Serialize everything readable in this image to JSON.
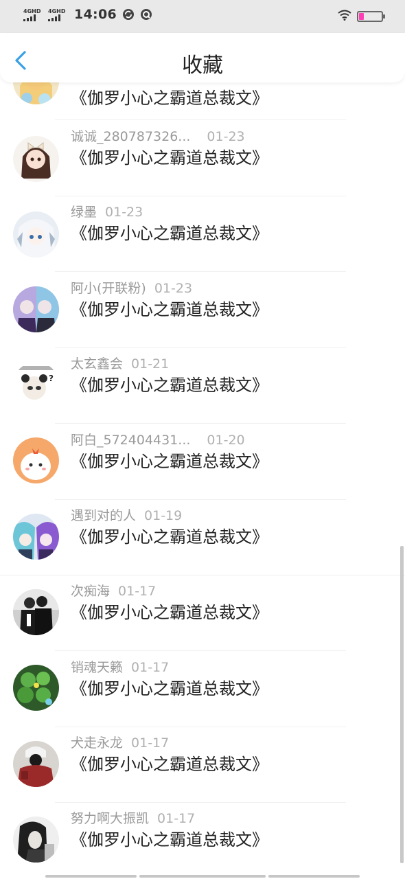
{
  "status_bar": {
    "net1": "4GHD",
    "net2": "4GHD",
    "time": "14:06",
    "battery_color": "#ff3fb4",
    "battery_level": 0.2
  },
  "header": {
    "title": "收藏",
    "back_icon": "chevron-left-icon",
    "accent_color": "#3aa0e6"
  },
  "items": [
    {
      "user": "",
      "date": "",
      "title": "《伽罗小心之霸道总裁文》",
      "avatar": "anime-girl-yellow"
    },
    {
      "user": "诚诚_280787326...",
      "date": "01-23",
      "title": "《伽罗小心之霸道总裁文》",
      "avatar": "anime-girl-bow"
    },
    {
      "user": "绿墨",
      "date": "01-23",
      "title": "《伽罗小心之霸道总裁文》",
      "avatar": "anime-white-hair"
    },
    {
      "user": "阿小(开联粉)",
      "date": "01-23",
      "title": "《伽罗小心之霸道总裁文》",
      "avatar": "anime-purple-pair"
    },
    {
      "user": "太玄鑫会",
      "date": "01-21",
      "title": "《伽罗小心之霸道总裁文》",
      "avatar": "panda-kid"
    },
    {
      "user": "阿白_572404431...",
      "date": "01-20",
      "title": "《伽罗小心之霸道总裁文》",
      "avatar": "orange-cartoon"
    },
    {
      "user": "遇到对的人",
      "date": "01-19",
      "title": "《伽罗小心之霸道总裁文》",
      "avatar": "anime-blue-purple"
    },
    {
      "user": "次痴海",
      "date": "01-17",
      "title": "《伽罗小心之霸道总裁文》",
      "avatar": "couple-photo"
    },
    {
      "user": "销魂天籁",
      "date": "01-17",
      "title": "《伽罗小心之霸道总裁文》",
      "avatar": "green-clover"
    },
    {
      "user": "犬走永龙",
      "date": "01-17",
      "title": "《伽罗小心之霸道总裁文》",
      "avatar": "red-hoodie"
    },
    {
      "user": "努力啊大振凯",
      "date": "01-17",
      "title": "《伽罗小心之霸道总裁文》",
      "avatar": "bw-girl"
    }
  ]
}
